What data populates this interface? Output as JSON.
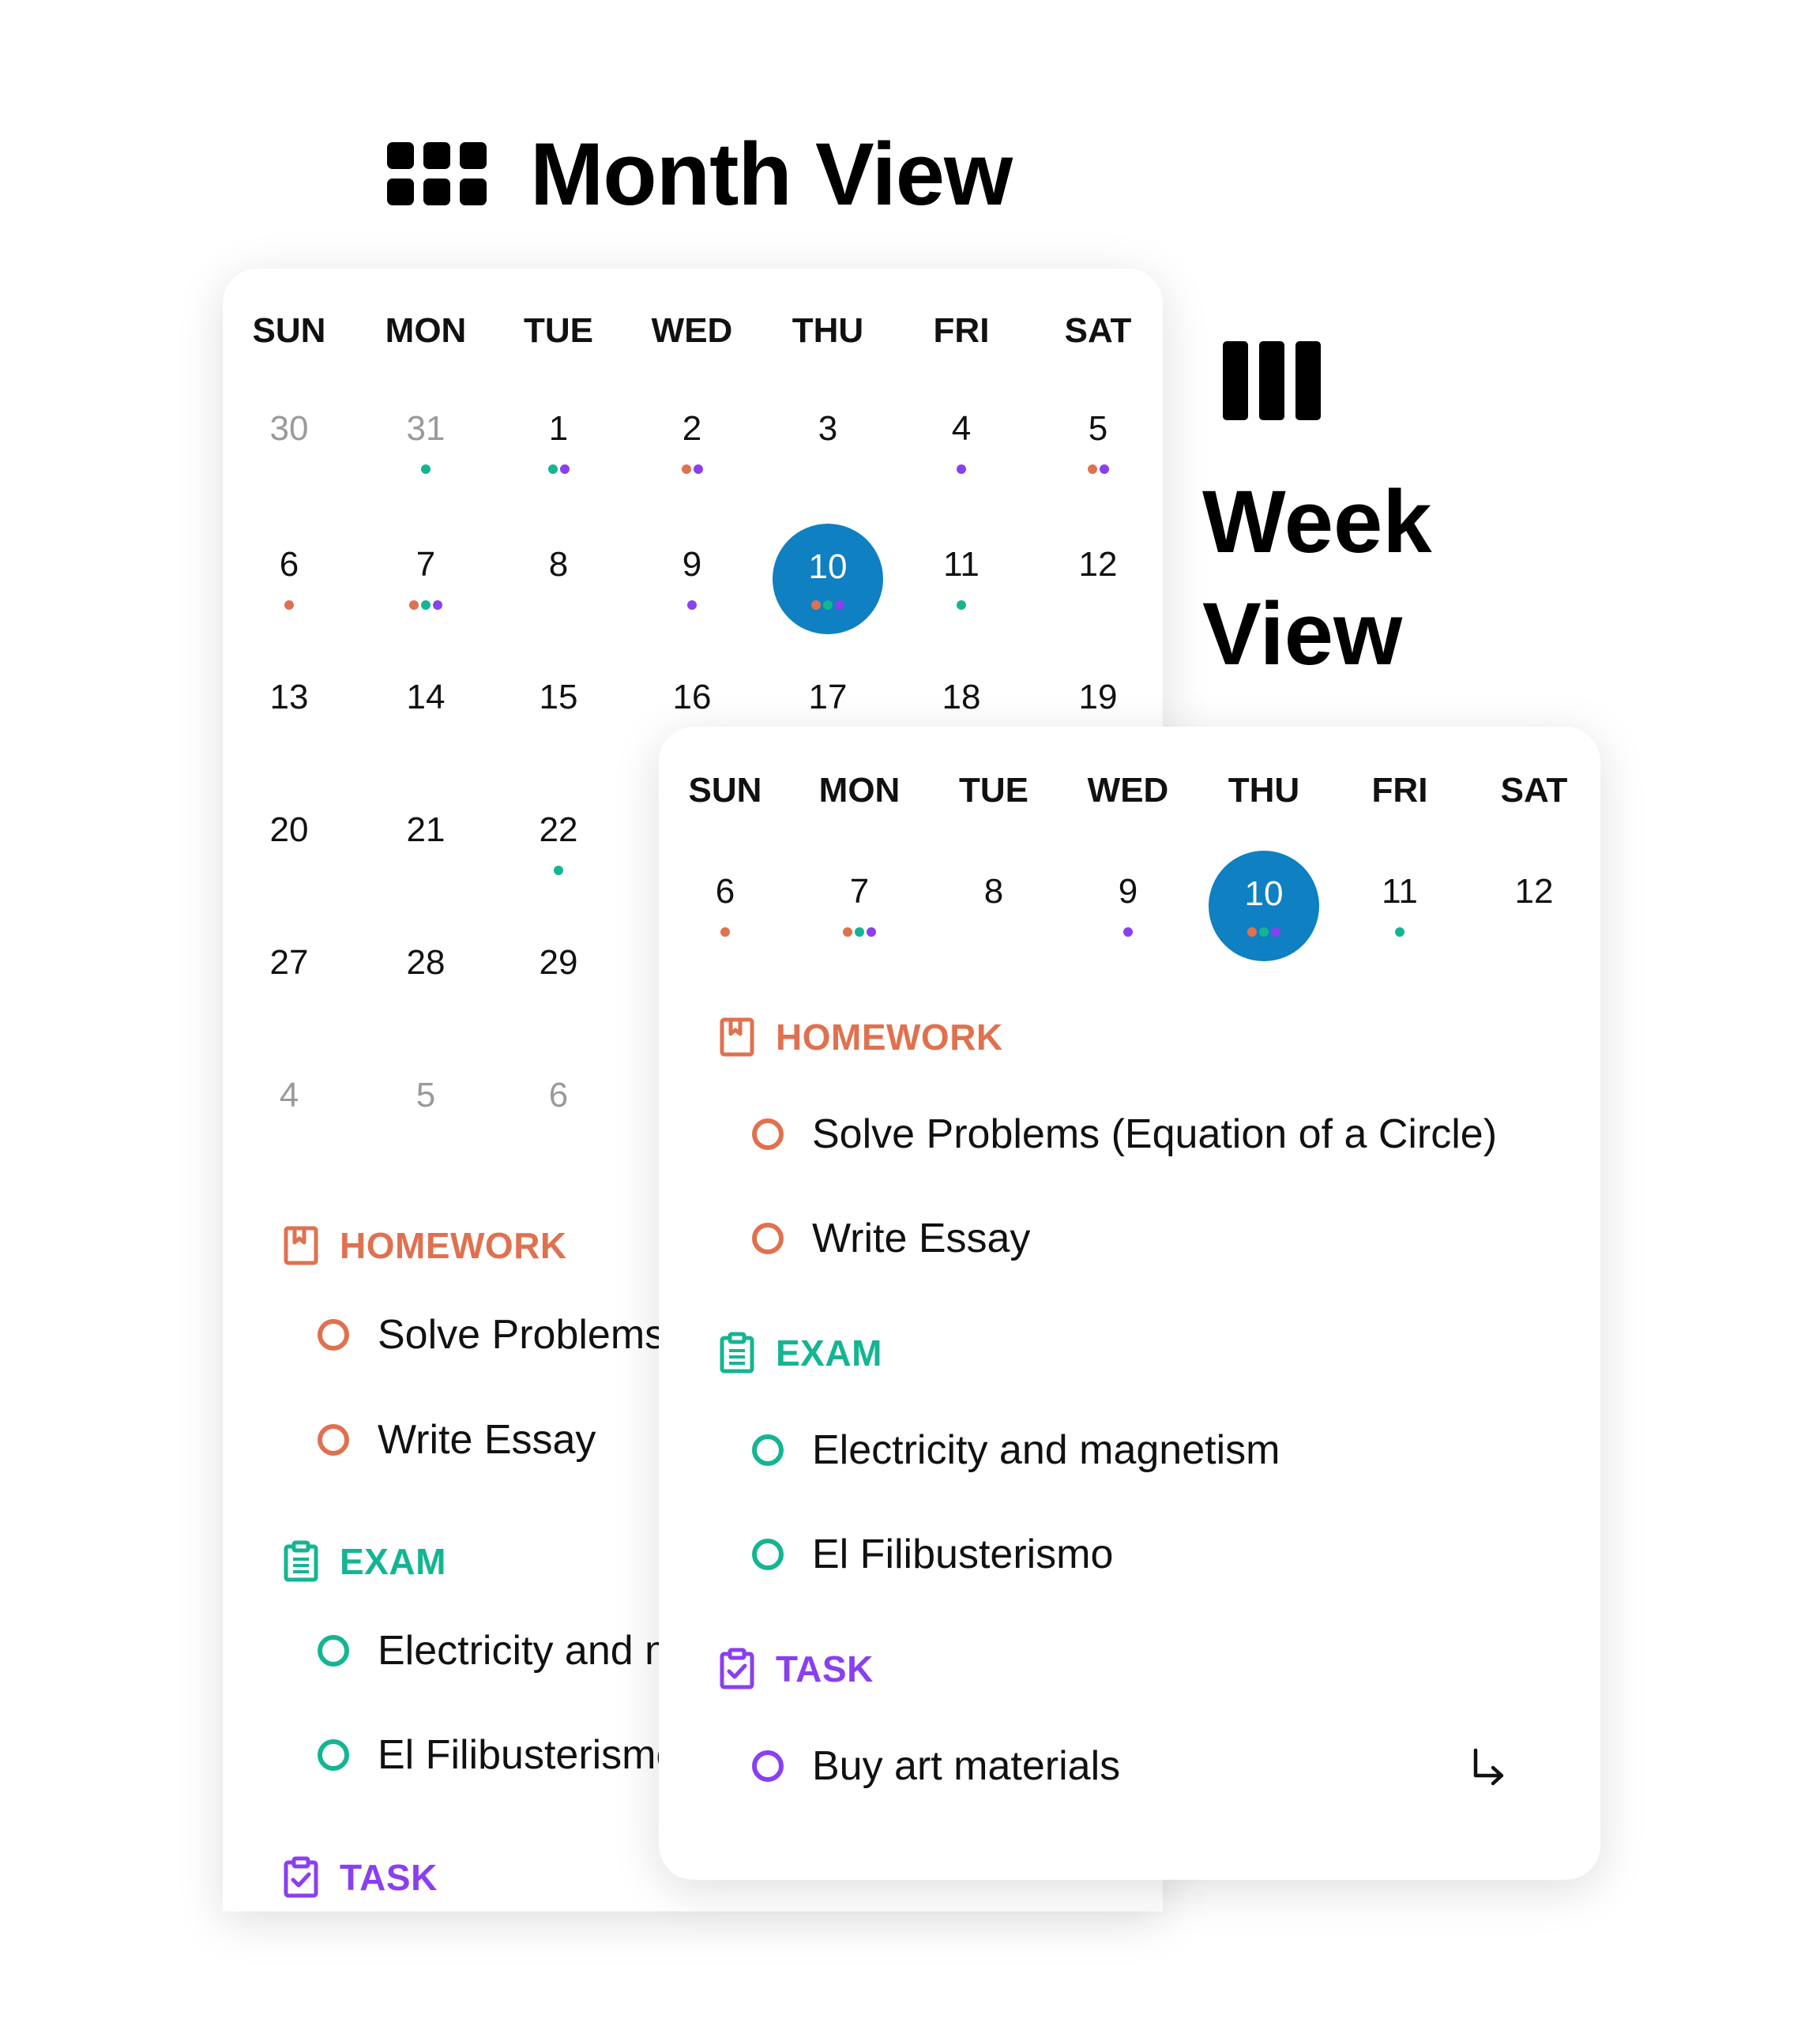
{
  "month_view": {
    "title": "Month View",
    "weekdays": [
      "SUN",
      "MON",
      "TUE",
      "WED",
      "THU",
      "FRI",
      "SAT"
    ],
    "weeks": [
      [
        "30",
        "31",
        "1",
        "2",
        "3",
        "4",
        "5"
      ],
      [
        "6",
        "7",
        "8",
        "9",
        "10",
        "11",
        "12"
      ],
      [
        "13",
        "14",
        "15",
        "16",
        "17",
        "18",
        "19"
      ],
      [
        "20",
        "21",
        "22"
      ],
      [
        "27",
        "28",
        "29"
      ],
      [
        "4",
        "5",
        "6"
      ]
    ],
    "sections": {
      "homework": {
        "label": "HOMEWORK",
        "items": [
          "Solve Problems",
          "Write Essay"
        ]
      },
      "exam": {
        "label": "EXAM",
        "items": [
          "Electricity and m",
          "El Filibusterismo"
        ]
      },
      "task": {
        "label": "TASK"
      }
    }
  },
  "week_view": {
    "title_line1": "Week",
    "title_line2": "View",
    "weekdays": [
      "SUN",
      "MON",
      "TUE",
      "WED",
      "THU",
      "FRI",
      "SAT"
    ],
    "days": [
      "6",
      "7",
      "8",
      "9",
      "10",
      "11",
      "12"
    ],
    "sections": {
      "homework": {
        "label": "HOMEWORK",
        "items": [
          "Solve Problems (Equation of a Circle)",
          "Write Essay"
        ]
      },
      "exam": {
        "label": "EXAM",
        "items": [
          "Electricity and magnetism",
          "El Filibusterismo"
        ]
      },
      "task": {
        "label": "TASK",
        "items": [
          "Buy art materials"
        ]
      }
    }
  },
  "colors": {
    "homework": "#e0714f",
    "exam": "#14b592",
    "task": "#8a3ff0",
    "today": "#0f80c1"
  },
  "icons": [
    "grid-icon",
    "columns-icon",
    "bookmark-book-icon",
    "clipboard-list-icon",
    "clipboard-check-icon",
    "return-arrow-icon"
  ]
}
